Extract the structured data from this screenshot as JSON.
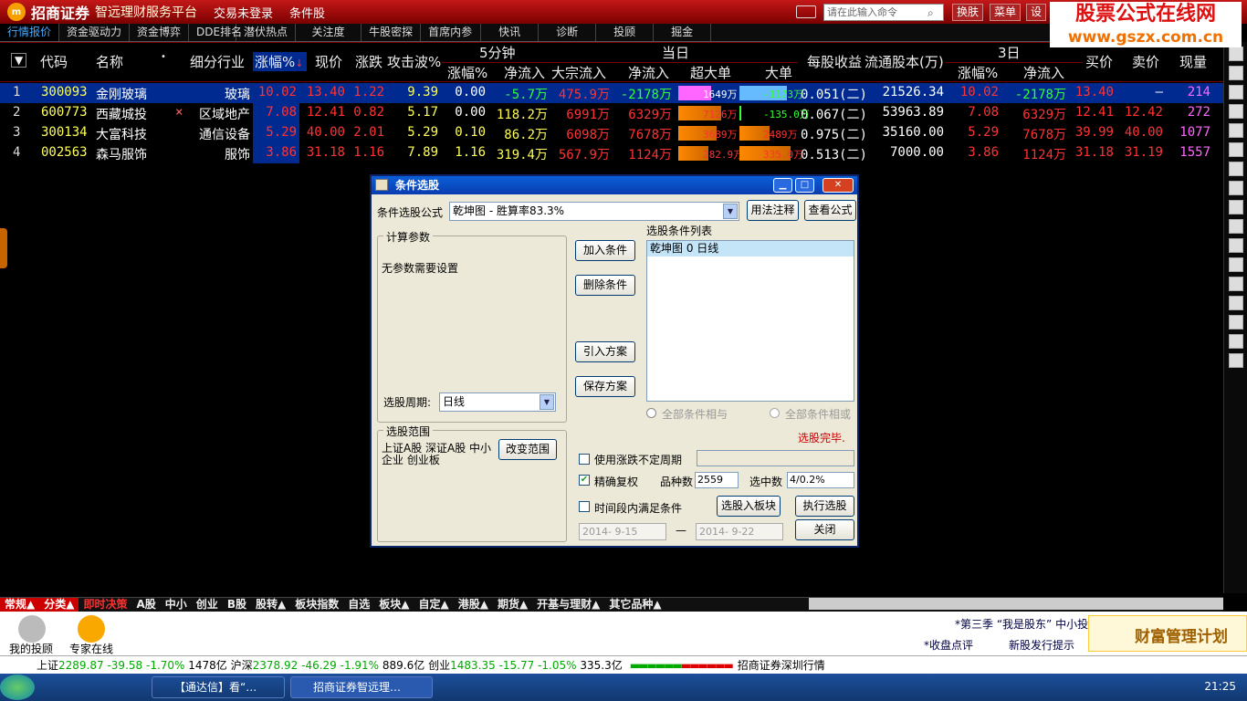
{
  "titlebar": {
    "logo": "m",
    "brand": "招商证券",
    "platform": "智远理财服务平台",
    "menu1": "交易未登录",
    "menu2": "条件股",
    "cmd_placeholder": "请在此输入命令",
    "btn1": "换肤",
    "btn2": "菜单",
    "btn3": "设"
  },
  "watermark": {
    "line1": "股票公式在线网",
    "line2": "www.gszx.com.cn"
  },
  "tabs": [
    "行情报价",
    "资金驱动力",
    "资金博弈",
    "DDE排名",
    "潜伏热点",
    "关注度",
    "牛股密探",
    "首席内参",
    "快讯",
    "诊断",
    "投顾",
    "掘金"
  ],
  "header": {
    "code": "代码",
    "name": "名称",
    "industry": "细分行业",
    "change": "涨幅%",
    "price": "现价",
    "delta": "涨跌",
    "attack": "攻击波%",
    "grp5": "5分钟",
    "today": "当日",
    "g5_change": "涨幅%",
    "g5_inflow": "净流入",
    "block": "大宗流入",
    "net": "净流入",
    "super": "超大单",
    "big": "大单",
    "eps": "每股收益",
    "float": "流通股本(万)",
    "grp3": "3日",
    "d3_change": "涨幅%",
    "d3_inflow": "净流入",
    "buy": "买价",
    "sell": "卖价",
    "vol": "现量"
  },
  "rows": [
    {
      "idx": "1",
      "code": "300093",
      "name": "金刚玻璃",
      "mark": "",
      "industry": "玻璃",
      "chg": "10.02",
      "price": "13.40",
      "delta": "1.22",
      "atk": "9.39",
      "g5c": "0.00",
      "g5i": "-5.7万",
      "blk": "475.9万",
      "net": "-2178万",
      "sup": "1649万",
      "big": "-1173万",
      "eps": "0.051(二)",
      "flt": "21526.34",
      "d3c": "10.02",
      "d3i": "-2178万",
      "buy": "13.40",
      "sell": "—",
      "vol": "214"
    },
    {
      "idx": "2",
      "code": "600773",
      "name": "西藏城投",
      "mark": "×",
      "industry": "区域地产",
      "chg": "7.08",
      "price": "12.41",
      "delta": "0.82",
      "atk": "5.17",
      "g5c": "0.00",
      "g5i": "118.2万",
      "blk": "6991万",
      "net": "6329万",
      "sup": "7126万",
      "big": "-135.0万",
      "eps": "0.067(二)",
      "flt": "53963.89",
      "d3c": "7.08",
      "d3i": "6329万",
      "buy": "12.41",
      "sell": "12.42",
      "vol": "272"
    },
    {
      "idx": "3",
      "code": "300134",
      "name": "大富科技",
      "mark": "",
      "industry": "通信设备",
      "chg": "5.29",
      "price": "40.00",
      "delta": "2.01",
      "atk": "5.29",
      "g5c": "0.10",
      "g5i": "86.2万",
      "blk": "6098万",
      "net": "7678万",
      "sup": "3689万",
      "big": "2489万",
      "eps": "0.975(二)",
      "flt": "35160.00",
      "d3c": "5.29",
      "d3i": "7678万",
      "buy": "39.99",
      "sell": "40.00",
      "vol": "1077"
    },
    {
      "idx": "4",
      "code": "002563",
      "name": "森马服饰",
      "mark": "",
      "industry": "服饰",
      "chg": "3.86",
      "price": "31.18",
      "delta": "1.16",
      "atk": "7.89",
      "g5c": "1.16",
      "g5i": "319.4万",
      "blk": "567.9万",
      "net": "1124万",
      "sup": "282.9万",
      "big": "335.0万",
      "eps": "0.513(二)",
      "flt": "7000.00",
      "d3c": "3.86",
      "d3i": "1124万",
      "buy": "31.18",
      "sell": "31.19",
      "vol": "1557"
    }
  ],
  "dialog": {
    "title": "条件选股",
    "formula_label": "条件选股公式",
    "formula_value": "乾坤图   - 胜算率83.3%",
    "btn_usage": "用法注释",
    "btn_view": "查看公式",
    "calc_params": "计算参数",
    "no_params": "无参数需要设置",
    "period_label": "选股周期:",
    "period_value": "日线",
    "btn_add": "加入条件",
    "btn_delete": "删除条件",
    "btn_import": "引入方案",
    "btn_save": "保存方案",
    "cond_list_label": "选股条件列表",
    "cond_item": "乾坤图  0  日线",
    "radio_and": "全部条件相与",
    "radio_or": "全部条件相或",
    "status": "选股完毕.",
    "scope_label": "选股范围",
    "scope_text": "上证A股 深证A股 中小企业 创业板",
    "btn_scope": "改变范围",
    "chk_vary": "使用涨跌不定周期",
    "chk_exact": "精确复权",
    "count_label": "品种数",
    "count_value": "2559",
    "sel_label": "选中数",
    "sel_value": "4/0.2%",
    "chk_time": "时间段内满足条件",
    "btn_to_block": "选股入板块",
    "btn_run": "执行选股",
    "date_from": "2014- 9-15",
    "dash": "—",
    "date_to": "2014- 9-22",
    "btn_close": "关闭"
  },
  "bottomtabs": [
    "常规▲",
    "分类▲",
    "即时决策",
    "A股",
    "中小",
    "创业",
    "B股",
    "股转▲",
    "板块指数",
    "自选",
    "板块▲",
    "自定▲",
    "港股▲",
    "期货▲",
    "开基与理财▲",
    "其它品种▲"
  ],
  "info": {
    "advisor": "我的投顾",
    "expert": "专家在线",
    "marquee1": "*第三季 “我是股东” 中小投",
    "link1": "*收盘点评",
    "link2": "新股发行提示",
    "fortune": "财富管理计划"
  },
  "indexbar": {
    "sh_label": "上证",
    "sh_value": "2289.87",
    "sh_delta": "-39.58",
    "sh_pct": "-1.70%",
    "sh_amt": "1478亿",
    "hs_label": "沪深",
    "hs_value": "2378.92",
    "hs_delta": "-46.29",
    "hs_pct": "-1.91%",
    "hs_amt": "889.6亿",
    "cy_label": "创业",
    "cy_value": "1483.35",
    "cy_delta": "-15.77",
    "cy_pct": "-1.05%",
    "cy_amt": "335.3亿",
    "feed": "招商证券深圳行情"
  },
  "taskbar": {
    "task1": "【通达信】看“…",
    "task2": "招商证券智远理…",
    "time": "21:25"
  },
  "colors": {
    "title_red": "#a00000",
    "up": "#ff3333",
    "value_yellow": "#ffff55",
    "select_blue": "#002a90",
    "magenta": "#ff66ff"
  }
}
